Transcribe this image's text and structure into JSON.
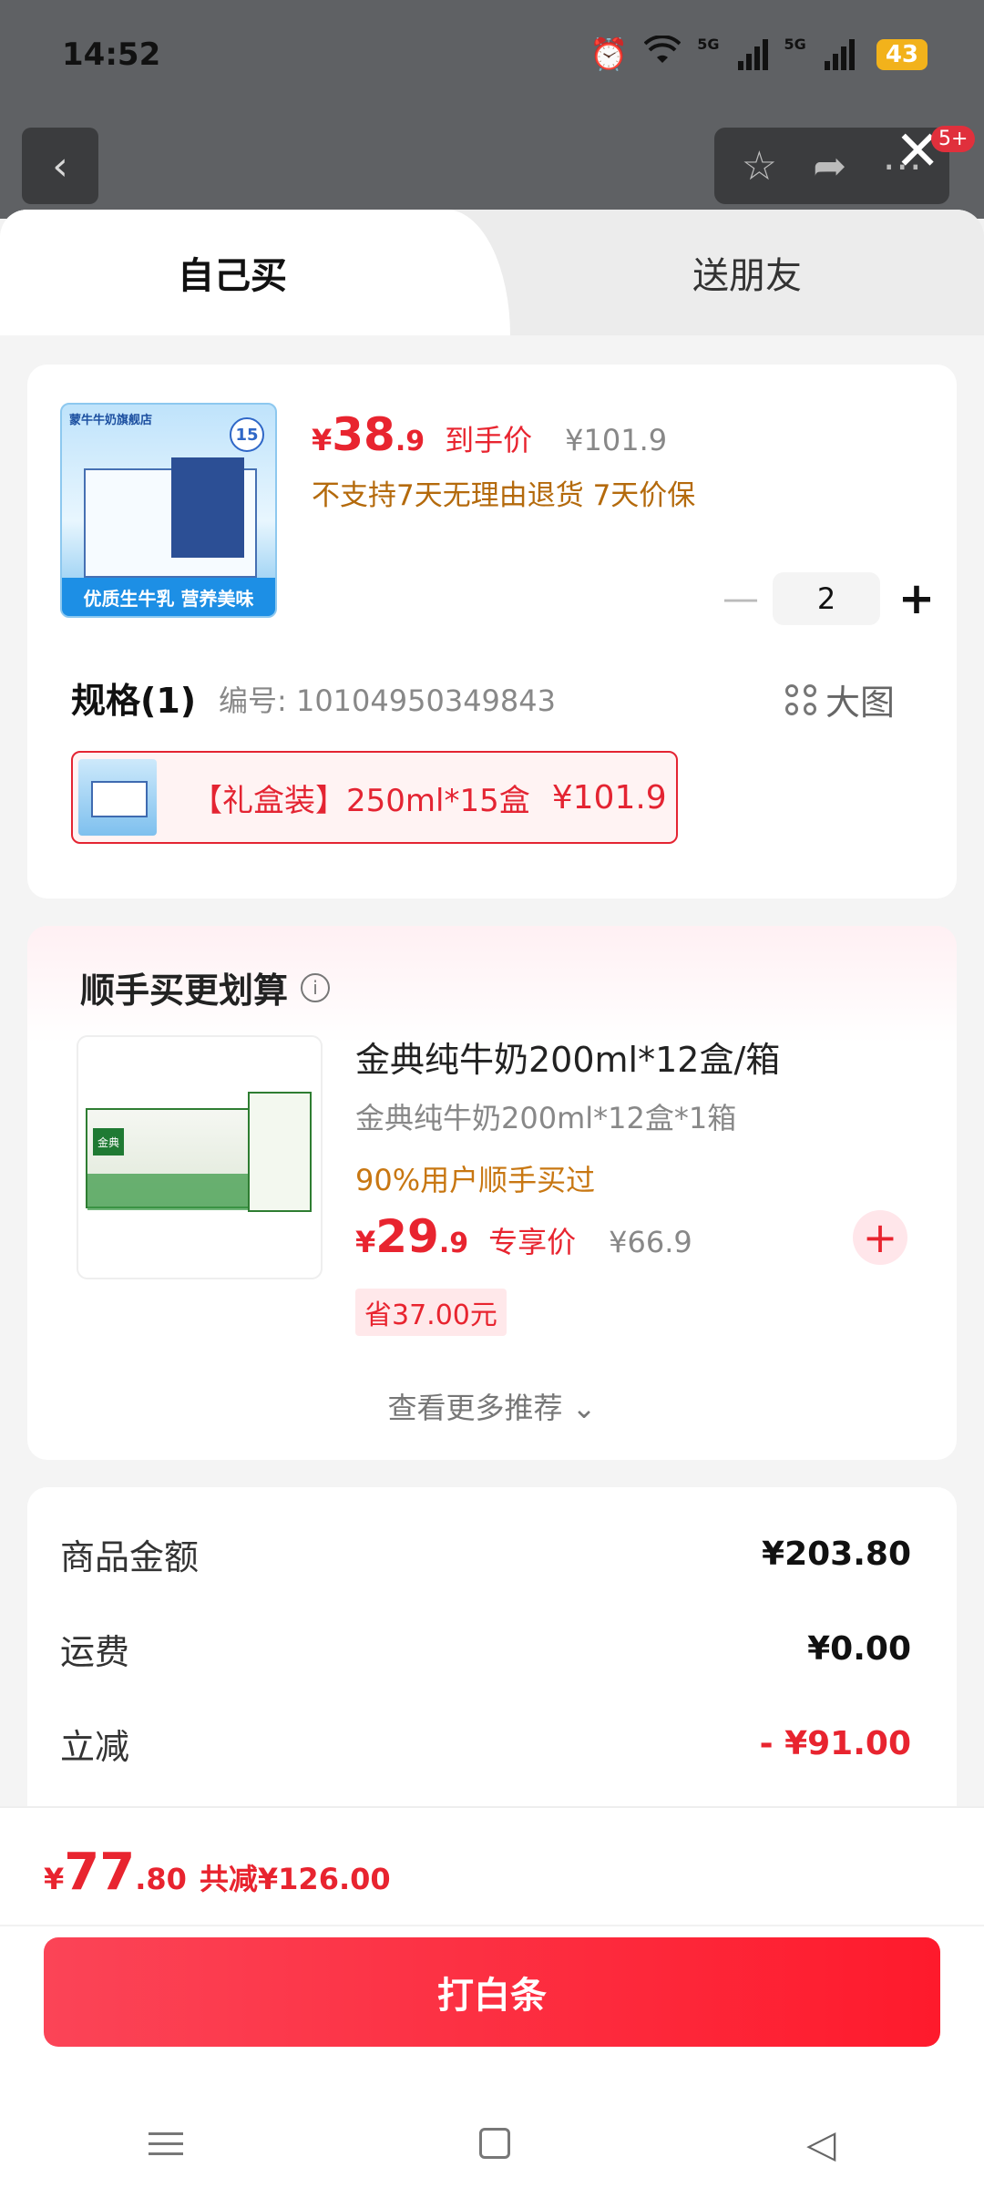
{
  "status_bar": {
    "time": "14:52",
    "network": "5G",
    "battery": "43"
  },
  "header": {
    "notification_badge": "5+"
  },
  "tabs": [
    {
      "label": "自己买"
    },
    {
      "label": "送朋友"
    }
  ],
  "product": {
    "image_store_text": "蒙牛牛奶旗舰店",
    "image_caption": "优质生牛乳 营养美味",
    "image_pack_count": "15",
    "price_yen": "¥",
    "price_int": "38",
    "price_dec": ".9",
    "price_label": "到手价",
    "original_price": "¥101.9",
    "policy": "不支持7天无理由退货  7天价保",
    "quantity": "2",
    "spec_title": "规格(1)",
    "spec_code": "编号: 10104950349843",
    "big_image_label": "大图",
    "spec_option": "【礼盒装】250ml*15盒",
    "spec_option_price": "¥101.9"
  },
  "recommend": {
    "title": "顺手买更划算",
    "item": {
      "name": "金典纯牛奶200ml*12盒/箱",
      "sub": "金典纯牛奶200ml*12盒*1箱",
      "hot": "90%用户顺手买过",
      "price_yen": "¥",
      "price_int": "29",
      "price_dec": ".9",
      "price_label": "专享价",
      "original_price": "¥66.9",
      "save": "省37.00元",
      "image_logo": "金典"
    },
    "more": "查看更多推荐 ⌄"
  },
  "summary": [
    {
      "label": "商品金额",
      "value": "¥203.80"
    },
    {
      "label": "运费",
      "value": "¥0.00"
    },
    {
      "label": "立减",
      "value": "- ¥91.00"
    }
  ],
  "checkout": {
    "yen": "¥",
    "total_int": "77",
    "total_dec": ".80",
    "total_save": "共减¥126.00",
    "pay_button": "打白条"
  },
  "colors": {
    "accent": "#e8242f",
    "hint": "#b46a0c"
  }
}
